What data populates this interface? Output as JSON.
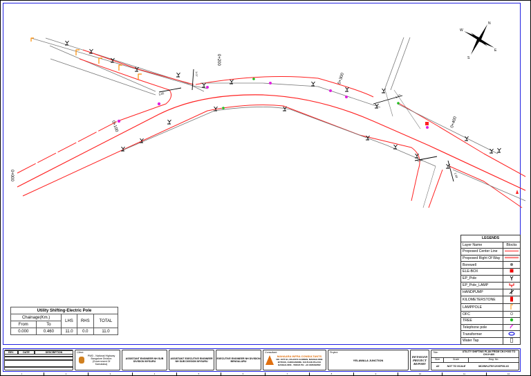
{
  "drawing": {
    "chainages": [
      "0+000",
      "0+100",
      "0+200",
      "0+300",
      "0+400"
    ],
    "dimensions": [
      "3.05",
      "1.77",
      "1.40",
      "1.07",
      "1.60"
    ],
    "compass": [
      "N",
      "E",
      "S",
      "W"
    ],
    "colors": {
      "row": "#ff2020",
      "row_light": "#f8a0a0",
      "utility": "#777777",
      "orange": "#ff8c00",
      "pink": "#e020e0",
      "green": "#20c020",
      "frame": "#2020e0"
    }
  },
  "legend": {
    "title": "LEGENDS",
    "header": [
      "Layer Name",
      "Blocks"
    ],
    "items": [
      {
        "name": "Proposed Center Line",
        "icon": "red-line"
      },
      {
        "name": "Proposed Right Of Way",
        "icon": "red-double-line"
      },
      {
        "name": "Borewell",
        "icon": "borewell-icon"
      },
      {
        "name": "ELE-BOX",
        "icon": "ele-box-icon"
      },
      {
        "name": "EP_Pole",
        "icon": "ep-pole-icon"
      },
      {
        "name": "EP_Pole_LAMP",
        "icon": "ep-pole-lamp-icon"
      },
      {
        "name": "HANDPUMP",
        "icon": "handpump-icon"
      },
      {
        "name": "KILOMETERSTONE",
        "icon": "kilometerstone-icon"
      },
      {
        "name": "LAMPPOLE",
        "icon": "lamppole-icon"
      },
      {
        "name": "OFC",
        "icon": "ofc-icon"
      },
      {
        "name": "TREE",
        "icon": "tree-icon"
      },
      {
        "name": "Telephone pole",
        "icon": "telephone-pole-icon"
      },
      {
        "name": "Transformer",
        "icon": "transformer-icon"
      },
      {
        "name": "Water Tap",
        "icon": "water-tap-icon"
      }
    ]
  },
  "utility_table": {
    "title": "Utility Shifting-Electric Pole",
    "chainage_header": "Chainage(Km.)",
    "from_label": "From",
    "to_label": "To",
    "columns": [
      "LHS",
      "RHS",
      "TOTAL"
    ],
    "row": {
      "from": "0.000",
      "to": "0.460",
      "lhs": "11.0",
      "rhs": "0.0",
      "total": "11.0"
    }
  },
  "title_block": {
    "revision_headers": [
      "REV.",
      "DATE",
      "DESCRIPTION"
    ],
    "client_caption": "Client:",
    "client": "PWD - National Highway Bangalore Division (Government Of Karnataka)",
    "assistant_engineer": "ASSISTANT ENGINEER NH SUB DIVISION MYSURU",
    "assistant_executive_engineer": "ASSISTANT EXECUTIVE ENGINEER NH SUB DIVISION MYSURU",
    "executive_engineer": "EXECUTIVE ENGINEER NH DIVISION BENGALURU",
    "consultant_caption": "Consultant:",
    "consultant": "MAHAARA INFRA CONSULTANTS",
    "consultant_address": "NO. 1075 S1, RAJAS'S GARDEN, MANGALORE BYPASS, CHIKKAMORE, SULTHAN PALAYA BANGALORE - 560024 PH: +91 9036499562",
    "project_caption": "Project:",
    "project": "YELAWALA JUNCTION",
    "report": "DETAILED PROJECT REPORT",
    "title_caption": "Title:",
    "title": "UTILITY SHIFTING PLAN FROM CH.0+000 TO CH.0+460",
    "size_caption": "Size",
    "scale_caption": "Scale",
    "dwg_caption": "Dwg. No.",
    "size": "A3",
    "scale": "NOT TO SCALE",
    "dwg_no": "MCI/NH-275/YJ/USP/01-01"
  },
  "grid_numbers": [
    "1",
    "2",
    "3",
    "4",
    "5",
    "6",
    "7",
    "8",
    "9",
    "10",
    "11",
    "12"
  ]
}
